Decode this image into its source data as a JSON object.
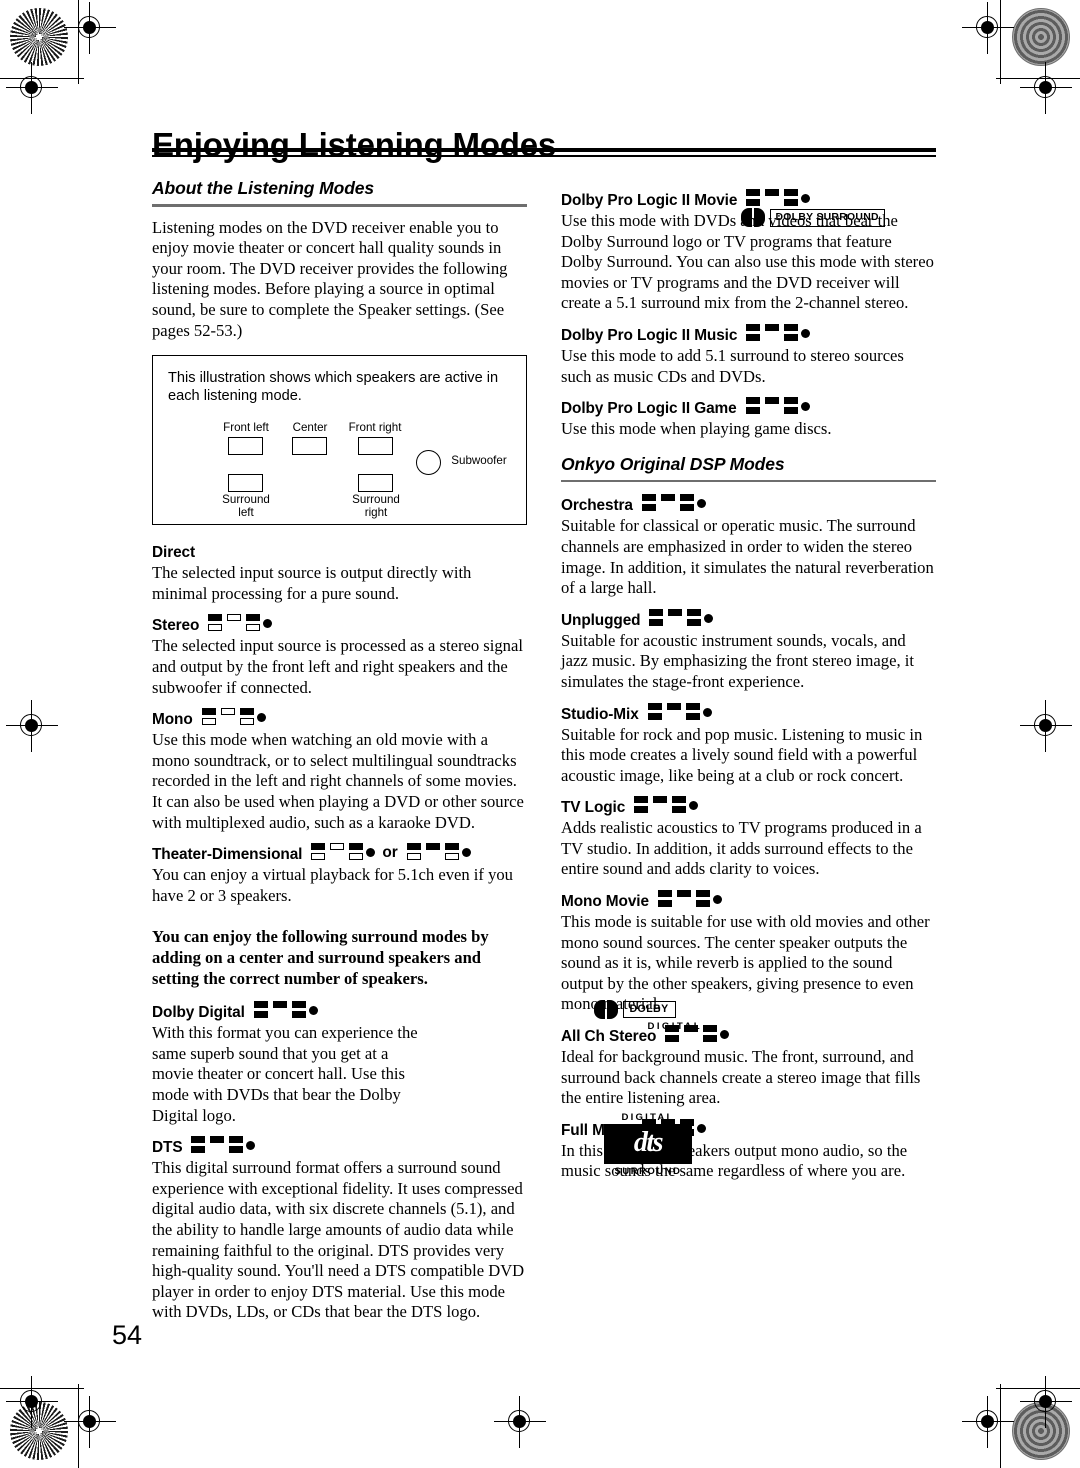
{
  "page": {
    "title": "Enjoying Listening Modes",
    "number": "54"
  },
  "left_column": {
    "section_title": "About the Listening Modes",
    "intro": "Listening modes on the DVD receiver enable you to enjoy movie theater or concert hall quality sounds in your room. The DVD receiver provides the following listening modes. Before playing a source in optimal sound, be sure to complete the Speaker settings. (See pages 52-53.)",
    "illustration": {
      "caption": "This illustration shows which speakers are active in each listening mode.",
      "labels": {
        "front_left": "Front left",
        "center": "Center",
        "front_right": "Front right",
        "subwoofer": "Subwoofer",
        "surround_left_line1": "Surround",
        "surround_left_line2": "left",
        "surround_right_line1": "Surround",
        "surround_right_line2": "right"
      }
    },
    "bold_note": "You can enjoy the following surround modes by adding on a center and surround speakers and setting the correct number of speakers.",
    "modes": [
      {
        "name": "Direct",
        "icon": null,
        "text": "The selected input source is output directly with minimal processing for a pure sound."
      },
      {
        "name": "Stereo",
        "icon": {
          "front_left": true,
          "center": false,
          "front_right": true,
          "surround_left": false,
          "surround_right": false,
          "subwoofer": true
        },
        "text": "The selected input source is processed as a stereo signal and output by the front left and right speakers and the subwoofer if connected."
      },
      {
        "name": "Mono",
        "icon": {
          "front_left": true,
          "center": false,
          "front_right": true,
          "surround_left": false,
          "surround_right": false,
          "subwoofer": true
        },
        "text": "Use this mode when watching an old movie with a mono soundtrack, or to select multilingual soundtracks recorded in the left and right channels of some movies. It can also be used when playing a DVD or other source with multiplexed audio, such as a karaoke DVD."
      },
      {
        "name": "Theater-Dimensional",
        "or_label": "or",
        "icon": {
          "front_left": true,
          "center": false,
          "front_right": true,
          "surround_left": false,
          "surround_right": false,
          "subwoofer": true
        },
        "icon2": {
          "front_left": true,
          "center": true,
          "front_right": true,
          "surround_left": false,
          "surround_right": false,
          "subwoofer": true
        },
        "text": "You can enjoy a virtual playback for 5.1ch even if you have 2 or 3 speakers."
      },
      {
        "name": "Dolby Digital",
        "icon": {
          "front_left": true,
          "center": true,
          "front_right": true,
          "surround_left": true,
          "surround_right": true,
          "subwoofer": true
        },
        "text": "With this format you can experience the same superb sound that you get at a movie theater or concert hall. Use this mode with DVDs that bear the Dolby Digital logo."
      },
      {
        "name": "DTS",
        "icon": {
          "front_left": true,
          "center": true,
          "front_right": true,
          "surround_left": true,
          "surround_right": true,
          "subwoofer": true
        },
        "text": "This digital surround format offers a surround sound experience with exceptional fidelity. It uses compressed digital audio data, with six discrete channels (5.1), and the ability to handle large amounts of audio data while remaining faithful to the original. DTS provides very high-quality sound. You'll need a DTS compatible DVD player in order to enjoy DTS material. Use this mode with DVDs, LDs, or CDs that bear the DTS logo."
      }
    ]
  },
  "right_column": {
    "section_title": "Onkyo Original DSP Modes",
    "modes_top": [
      {
        "name": "Dolby Pro Logic II Movie",
        "icon": {
          "front_left": true,
          "center": true,
          "front_right": true,
          "surround_left": true,
          "surround_right": true,
          "subwoofer": true
        },
        "text": "Use this mode with DVDs and videos that bear the Dolby Surround logo or TV programs that feature Dolby Surround. You can also use this mode with stereo movies or TV programs and the DVD receiver will create a 5.1 surround mix from the 2-channel stereo."
      },
      {
        "name": "Dolby Pro Logic II Music",
        "icon": {
          "front_left": true,
          "center": true,
          "front_right": true,
          "surround_left": true,
          "surround_right": true,
          "subwoofer": true
        },
        "text": "Use this mode to add 5.1 surround to stereo sources such as music CDs and DVDs."
      },
      {
        "name": "Dolby Pro Logic II Game",
        "icon": {
          "front_left": true,
          "center": true,
          "front_right": true,
          "surround_left": true,
          "surround_right": true,
          "subwoofer": true
        },
        "text": "Use this mode when playing game discs."
      }
    ],
    "modes_dsp": [
      {
        "name": "Orchestra",
        "icon": {
          "front_left": true,
          "center": true,
          "front_right": true,
          "surround_left": true,
          "surround_right": true,
          "subwoofer": true
        },
        "text": "Suitable for classical or operatic music. The surround channels are emphasized in order to widen the stereo image. In addition, it simulates the natural reverberation of a large hall."
      },
      {
        "name": "Unplugged",
        "icon": {
          "front_left": true,
          "center": true,
          "front_right": true,
          "surround_left": true,
          "surround_right": true,
          "subwoofer": true
        },
        "text": "Suitable for acoustic instrument sounds, vocals, and jazz music. By emphasizing the front stereo image, it simulates the stage-front experience."
      },
      {
        "name": "Studio-Mix",
        "icon": {
          "front_left": true,
          "center": true,
          "front_right": true,
          "surround_left": true,
          "surround_right": true,
          "subwoofer": true
        },
        "text": "Suitable for rock and pop music. Listening to music in this mode creates a lively sound field with a powerful acoustic image, like being at a club or rock concert."
      },
      {
        "name": "TV Logic",
        "icon": {
          "front_left": true,
          "center": true,
          "front_right": true,
          "surround_left": true,
          "surround_right": true,
          "subwoofer": true
        },
        "text": "Adds realistic acoustics to TV programs produced in a TV studio. In addition, it adds surround effects to the entire sound and adds clarity to voices."
      },
      {
        "name": "Mono Movie",
        "icon": {
          "front_left": true,
          "center": true,
          "front_right": true,
          "surround_left": true,
          "surround_right": true,
          "subwoofer": true
        },
        "text": "This mode is suitable for use with old movies and other mono sound sources. The center speaker outputs the sound as it is, while reverb is applied to the sound output by the other speakers, giving presence to even mono material."
      },
      {
        "name": "All Ch Stereo",
        "icon": {
          "front_left": true,
          "center": true,
          "front_right": true,
          "surround_left": true,
          "surround_right": true,
          "subwoofer": true
        },
        "text": "Ideal for background music. The front, surround, and surround back channels create a stereo image that fills the entire listening area."
      },
      {
        "name": "Full Mono",
        "icon": {
          "front_left": true,
          "center": true,
          "front_right": true,
          "surround_left": true,
          "surround_right": true,
          "subwoofer": true
        },
        "text": "In this mode, all speakers output mono audio, so the music sounds the same regardless of where you are."
      }
    ]
  },
  "logos": {
    "dolby_surround": {
      "mark": "double-d",
      "text": "DOLBY SURROUND"
    },
    "dolby_digital": {
      "mark": "double-d",
      "text": "DOLBY",
      "sub": "DIGITAL"
    },
    "dts": {
      "top": "DIGITAL",
      "main": "dts",
      "bottom": "SURROUND"
    }
  }
}
